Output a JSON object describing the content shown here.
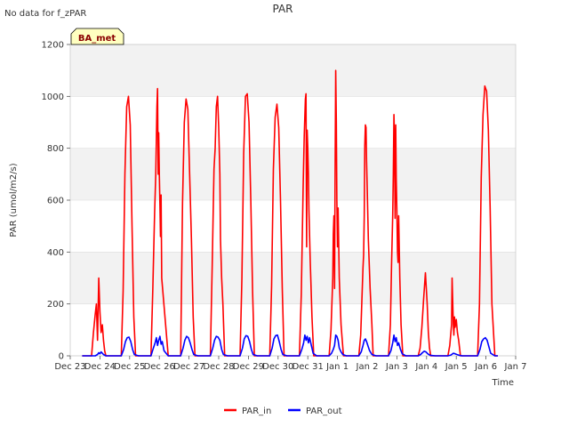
{
  "top_note": "No data for f_zPAR",
  "badge": "BA_met",
  "colors": {
    "PAR_in": "#ff0000",
    "PAR_out": "#0000ff",
    "band": "#f2f2f2",
    "grid": "#dddddd",
    "badge_fill": "#ffffc0",
    "badge_text": "#8b0000"
  },
  "chart_data": {
    "type": "line",
    "title": "PAR",
    "xlabel": "Time",
    "ylabel": "PAR (umol/m2/s)",
    "ylim": [
      0,
      1200
    ],
    "yticks": [
      0,
      200,
      400,
      600,
      800,
      1000,
      1200
    ],
    "xlim": [
      0,
      15
    ],
    "xtick_labels": [
      "Dec 23",
      "Dec 24",
      "Dec 25",
      "Dec 26",
      "Dec 27",
      "Dec 28",
      "Dec 29",
      "Dec 30",
      "Dec 31",
      "Jan 1",
      "Jan 2",
      "Jan 3",
      "Jan 4",
      "Jan 5",
      "Jan 6",
      "Jan 7"
    ],
    "grid": true,
    "legend_position": "bottom-center",
    "series": [
      {
        "name": "PAR_in",
        "x": [
          0.4,
          0.72,
          0.78,
          0.84,
          0.88,
          0.92,
          0.96,
          1.0,
          1.04,
          1.08,
          1.12,
          1.16,
          1.2,
          1.3,
          1.72,
          1.78,
          1.84,
          1.9,
          1.96,
          2.02,
          2.08,
          2.14,
          2.2,
          2.3,
          2.72,
          2.78,
          2.84,
          2.88,
          2.92,
          2.94,
          2.96,
          2.98,
          3.0,
          3.02,
          3.04,
          3.06,
          3.08,
          3.3,
          3.72,
          3.78,
          3.84,
          3.9,
          3.96,
          4.02,
          4.08,
          4.14,
          4.2,
          4.3,
          4.72,
          4.78,
          4.84,
          4.88,
          4.92,
          4.96,
          5.0,
          5.04,
          5.06,
          5.1,
          5.14,
          5.2,
          5.3,
          5.72,
          5.78,
          5.84,
          5.9,
          5.96,
          6.02,
          6.08,
          6.14,
          6.2,
          6.3,
          6.72,
          6.78,
          6.84,
          6.9,
          6.96,
          7.02,
          7.08,
          7.14,
          7.2,
          7.3,
          7.72,
          7.78,
          7.84,
          7.88,
          7.92,
          7.94,
          7.96,
          7.98,
          8.0,
          8.02,
          8.04,
          8.08,
          8.14,
          8.2,
          8.3,
          8.72,
          8.78,
          8.84,
          8.86,
          8.88,
          8.9,
          8.92,
          8.94,
          8.96,
          8.98,
          9.0,
          9.02,
          9.06,
          9.12,
          9.2,
          9.3,
          9.72,
          9.78,
          9.84,
          9.86,
          9.88,
          9.9,
          9.92,
          9.94,
          9.96,
          9.98,
          10.0,
          10.04,
          10.1,
          10.16,
          10.2,
          10.3,
          10.72,
          10.78,
          10.82,
          10.86,
          10.88,
          10.9,
          10.92,
          10.94,
          10.96,
          10.98,
          11.0,
          11.02,
          11.04,
          11.06,
          11.1,
          11.14,
          11.2,
          11.3,
          11.72,
          11.78,
          11.84,
          11.9,
          11.96,
          12.02,
          12.06,
          12.1,
          12.14,
          12.2,
          12.72,
          12.78,
          12.84,
          12.86,
          12.88,
          12.9,
          12.92,
          12.94,
          12.96,
          13.0,
          13.04,
          13.08,
          13.14,
          13.2,
          13.72,
          13.78,
          13.84,
          13.9,
          13.96,
          14.02,
          14.08,
          14.14,
          14.2,
          14.3,
          14.4
        ],
        "y": [
          0,
          0,
          90,
          160,
          200,
          60,
          300,
          170,
          90,
          120,
          60,
          20,
          0,
          0,
          0,
          250,
          700,
          960,
          1000,
          890,
          500,
          150,
          0,
          0,
          0,
          260,
          550,
          700,
          960,
          1030,
          700,
          860,
          700,
          580,
          460,
          620,
          300,
          0,
          0,
          590,
          900,
          990,
          950,
          700,
          450,
          150,
          0,
          0,
          0,
          350,
          720,
          800,
          960,
          1000,
          880,
          700,
          450,
          300,
          200,
          0,
          0,
          0,
          300,
          780,
          1000,
          1010,
          900,
          600,
          250,
          0,
          0,
          0,
          270,
          720,
          920,
          970,
          880,
          600,
          260,
          0,
          0,
          0,
          240,
          640,
          850,
          990,
          1010,
          420,
          870,
          800,
          700,
          560,
          370,
          150,
          0,
          0,
          0,
          100,
          300,
          470,
          540,
          260,
          700,
          1100,
          900,
          600,
          420,
          570,
          300,
          120,
          0,
          0,
          0,
          80,
          280,
          340,
          390,
          540,
          810,
          890,
          880,
          750,
          650,
          450,
          260,
          120,
          0,
          0,
          0,
          120,
          350,
          540,
          700,
          930,
          840,
          530,
          890,
          680,
          560,
          400,
          360,
          540,
          300,
          120,
          0,
          0,
          0,
          30,
          110,
          220,
          320,
          200,
          90,
          30,
          0,
          0,
          0,
          40,
          120,
          300,
          210,
          120,
          80,
          150,
          110,
          140,
          90,
          60,
          0,
          0,
          0,
          200,
          690,
          930,
          1040,
          1020,
          870,
          570,
          200,
          0,
          0
        ]
      },
      {
        "name": "PAR_out",
        "x": [
          0.4,
          0.84,
          0.92,
          0.96,
          1.0,
          1.04,
          1.12,
          1.2,
          1.3,
          1.72,
          1.8,
          1.86,
          1.92,
          1.98,
          2.04,
          2.1,
          2.16,
          2.3,
          2.72,
          2.8,
          2.86,
          2.9,
          2.94,
          2.98,
          3.02,
          3.06,
          3.1,
          3.16,
          3.3,
          3.72,
          3.8,
          3.86,
          3.92,
          3.98,
          4.04,
          4.1,
          4.16,
          4.3,
          4.72,
          4.8,
          4.86,
          4.92,
          4.98,
          5.04,
          5.1,
          5.16,
          5.3,
          5.72,
          5.8,
          5.86,
          5.92,
          5.98,
          6.04,
          6.1,
          6.16,
          6.3,
          6.72,
          6.8,
          6.86,
          6.92,
          6.98,
          7.04,
          7.1,
          7.16,
          7.3,
          7.72,
          7.8,
          7.86,
          7.9,
          7.94,
          7.98,
          8.02,
          8.06,
          8.12,
          8.18,
          8.3,
          8.72,
          8.8,
          8.86,
          8.9,
          8.94,
          8.98,
          9.02,
          9.06,
          9.12,
          9.18,
          9.3,
          9.72,
          9.8,
          9.86,
          9.9,
          9.94,
          9.98,
          10.02,
          10.08,
          10.16,
          10.3,
          10.72,
          10.8,
          10.86,
          10.9,
          10.94,
          10.98,
          11.02,
          11.06,
          11.12,
          11.18,
          11.3,
          11.72,
          11.8,
          11.86,
          11.92,
          11.98,
          12.04,
          12.12,
          12.3,
          12.72,
          12.82,
          12.9,
          12.96,
          13.02,
          13.1,
          13.2,
          13.72,
          13.8,
          13.86,
          13.92,
          13.98,
          14.04,
          14.1,
          14.16,
          14.3,
          14.4
        ],
        "y": [
          0,
          0,
          5,
          12,
          8,
          15,
          5,
          0,
          0,
          0,
          25,
          55,
          70,
          72,
          55,
          25,
          5,
          0,
          0,
          30,
          50,
          70,
          40,
          60,
          75,
          45,
          55,
          20,
          0,
          0,
          30,
          60,
          75,
          70,
          50,
          25,
          5,
          0,
          0,
          30,
          60,
          75,
          72,
          60,
          25,
          5,
          0,
          0,
          30,
          65,
          78,
          75,
          55,
          25,
          5,
          0,
          0,
          30,
          65,
          78,
          80,
          55,
          25,
          5,
          0,
          0,
          25,
          50,
          80,
          60,
          75,
          50,
          70,
          40,
          10,
          0,
          0,
          10,
          25,
          40,
          80,
          75,
          60,
          30,
          15,
          5,
          0,
          0,
          15,
          40,
          60,
          65,
          55,
          40,
          20,
          5,
          0,
          0,
          20,
          50,
          80,
          55,
          70,
          40,
          50,
          25,
          8,
          0,
          0,
          5,
          12,
          18,
          15,
          8,
          2,
          0,
          0,
          3,
          10,
          8,
          5,
          2,
          0,
          0,
          25,
          55,
          65,
          70,
          60,
          35,
          10,
          0,
          0
        ]
      }
    ]
  }
}
